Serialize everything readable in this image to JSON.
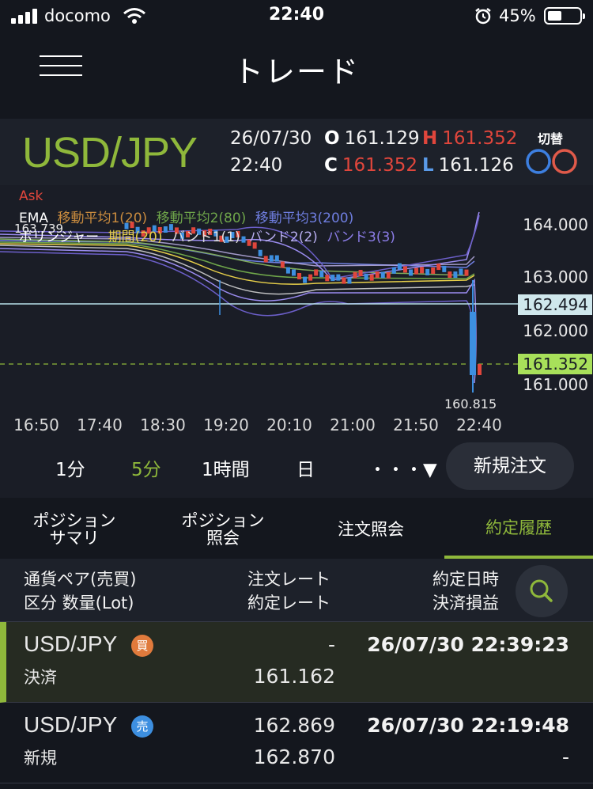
{
  "status_bar": {
    "carrier": "docomo",
    "time": "22:40",
    "battery": "45%"
  },
  "header": {
    "title": "トレード"
  },
  "pair": {
    "name": "USD/JPY",
    "date": "26/07/30",
    "time": "22:40",
    "open_label": "O",
    "open": "161.129",
    "high_label": "H",
    "high": "161.352",
    "close_label": "C",
    "close": "161.352",
    "low_label": "L",
    "low": "161.126",
    "switch_label": "切替"
  },
  "chart": {
    "price_type": "Ask",
    "legend_ma": [
      "EMA",
      "移動平均1(20)",
      "移動平均2(80)",
      "移動平均3(200)"
    ],
    "legend_bb": [
      "ボリンジャー",
      "期間(20)",
      "バンド1(1)",
      "バンド2(2)",
      "バンド3(3)"
    ],
    "high_marker": "163.739",
    "low_marker": "160.815",
    "current_line": "162.494",
    "last_price": "161.352",
    "colors": {
      "ask": "#e0463c",
      "ma1": "#c98b3e",
      "ma2": "#6fa64a",
      "ma3": "#6f7ee0",
      "bb_period": "#e8d04a",
      "bb_band": "#9b8cf0",
      "up": "#e0463c",
      "down": "#3d8fe0",
      "accent": "#8fb83b"
    }
  },
  "chart_data": {
    "type": "line",
    "x": [
      "16:50",
      "17:40",
      "18:30",
      "19:20",
      "20:10",
      "21:00",
      "21:50",
      "22:40"
    ],
    "y_ticks": [
      "164.000",
      "163.000",
      "162.000",
      "161.000"
    ],
    "ylim": [
      160.7,
      164.2
    ],
    "series": [
      {
        "name": "Ask",
        "values": [
          163.6,
          163.55,
          163.45,
          162.8,
          162.75,
          162.9,
          162.85,
          161.35
        ]
      }
    ]
  },
  "timeframes": [
    "1分",
    "5分",
    "1時間",
    "日",
    "・・・▼"
  ],
  "new_order": "新規注文",
  "tabs": [
    "ポジション\nサマリ",
    "ポジション\n照会",
    "注文照会",
    "約定履歴"
  ],
  "history_header": {
    "col1_line1": "通貨ペア(売買)",
    "col1_line2": "区分 数量(Lot)",
    "col2_line1": "注文レート",
    "col2_line2": "約定レート",
    "col3_line1": "約定日時",
    "col3_line2": "決済損益"
  },
  "rows": [
    {
      "pair": "USD/JPY",
      "side": "買",
      "type": "決済",
      "order_rate": "-",
      "exec_rate": "161.162",
      "datetime": "26/07/30 22:39:23",
      "pl": ""
    },
    {
      "pair": "USD/JPY",
      "side": "売",
      "type": "新規",
      "order_rate": "162.869",
      "exec_rate": "162.870",
      "datetime": "26/07/30 22:19:48",
      "pl": "-"
    }
  ]
}
